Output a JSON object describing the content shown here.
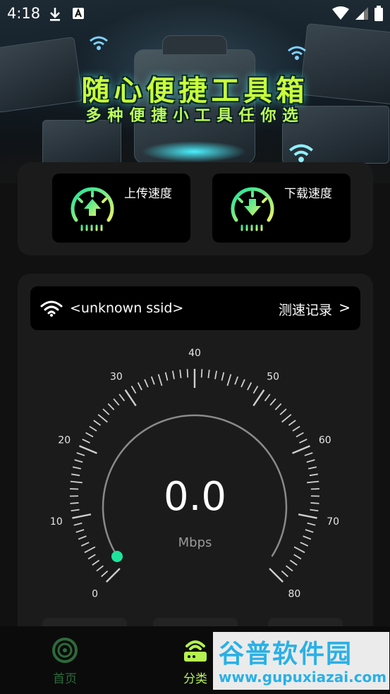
{
  "status_bar": {
    "time": "4:18"
  },
  "banner": {
    "title": "随心便捷工具箱",
    "subtitle": "多种便捷小工具任你选"
  },
  "speed_buttons": {
    "upload_label": "上传速度",
    "download_label": "下载速度"
  },
  "network": {
    "ssid": "<unknown ssid>",
    "record_label": "测速记录",
    "chevron": ">"
  },
  "gauge": {
    "value": "0.0",
    "unit": "Mbps",
    "ticks": [
      "0",
      "10",
      "20",
      "30",
      "40",
      "50",
      "60",
      "70",
      "80"
    ],
    "level": 0.0
  },
  "bottom_nav": {
    "home_label": "首页",
    "category_label": "分类"
  },
  "watermark": {
    "text": "谷普软件园",
    "url": "www.gupuxiazai.com"
  },
  "colors": {
    "accent": "#a5f36a",
    "accent_start": "#19e39c",
    "card": "#1b1b1b",
    "dot": "#1ee39c"
  }
}
